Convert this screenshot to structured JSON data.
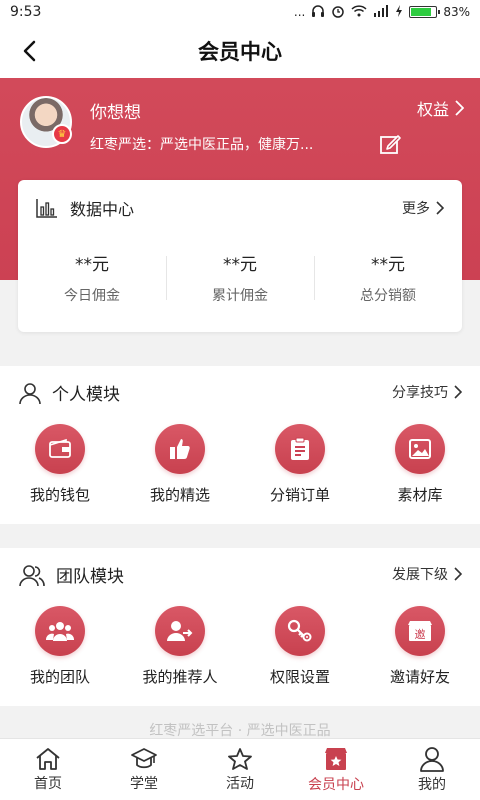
{
  "status_bar": {
    "time": "9:53",
    "signal_dots": "...",
    "battery_pct": "83%"
  },
  "header": {
    "title": "会员中心"
  },
  "profile": {
    "username": "你想想",
    "slogan": "红枣严选：严选中医正品，健康万...",
    "rights_label": "权益"
  },
  "data_center": {
    "title": "数据中心",
    "more_label": "更多",
    "stats": [
      {
        "value": "**元",
        "label": "今日佣金"
      },
      {
        "value": "**元",
        "label": "累计佣金"
      },
      {
        "value": "**元",
        "label": "总分销额"
      }
    ]
  },
  "personal_module": {
    "title": "个人模块",
    "link_label": "分享技巧",
    "items": [
      {
        "label": "我的钱包",
        "icon": "wallet-icon"
      },
      {
        "label": "我的精选",
        "icon": "thumbs-up-icon"
      },
      {
        "label": "分销订单",
        "icon": "order-icon"
      },
      {
        "label": "素材库",
        "icon": "image-icon"
      }
    ]
  },
  "team_module": {
    "title": "团队模块",
    "link_label": "发展下级",
    "items": [
      {
        "label": "我的团队",
        "icon": "team-icon"
      },
      {
        "label": "我的推荐人",
        "icon": "referrer-icon"
      },
      {
        "label": "权限设置",
        "icon": "key-gear-icon"
      },
      {
        "label": "邀请好友",
        "icon": "invite-icon",
        "icon_text": "邀"
      }
    ]
  },
  "footer_note": "红枣严选平台 · 严选中医正品",
  "tabbar": {
    "items": [
      {
        "label": "首页",
        "icon": "home-icon"
      },
      {
        "label": "学堂",
        "icon": "graduation-cap-icon"
      },
      {
        "label": "活动",
        "icon": "star-icon"
      },
      {
        "label": "会员中心",
        "icon": "member-center-icon",
        "active": true
      },
      {
        "label": "我的",
        "icon": "user-icon"
      }
    ]
  },
  "colors": {
    "accent": "#cc4153",
    "hero_bg": "#d24a5a",
    "text": "#222222"
  }
}
